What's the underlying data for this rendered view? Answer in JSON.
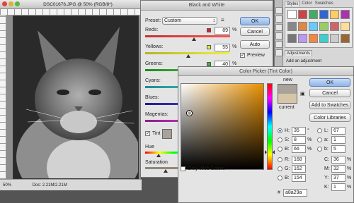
{
  "document": {
    "title": "DSC01676.JPG @ 50% (RGB/8*)",
    "zoom": "50%",
    "status": "Doc: 2.21M/2.21M"
  },
  "bw": {
    "title": "Black and White",
    "preset_label": "Preset:",
    "preset_value": "Custom",
    "ok": "OK",
    "cancel": "Cancel",
    "auto": "Auto",
    "preview": "Preview",
    "preview_checked": true,
    "sliders": [
      {
        "label": "Reds:",
        "value": "89",
        "unit": "%",
        "color": "#e02020",
        "g1": "#c23232",
        "g2": "#ff5050"
      },
      {
        "label": "Yellows:",
        "value": "55",
        "unit": "%",
        "color": "#e8e830",
        "g1": "#b4b41e",
        "g2": "#f0f040"
      },
      {
        "label": "Greens:",
        "value": "40",
        "unit": "%",
        "color": "#30c030",
        "g1": "#1e8c1e",
        "g2": "#50d050"
      },
      {
        "label": "Cyans:",
        "value": "",
        "unit": "",
        "color": "#30c0c0",
        "g1": "#1e8c8c",
        "g2": "#50d0d0"
      },
      {
        "label": "Blues:",
        "value": "",
        "unit": "",
        "color": "#2040e0",
        "g1": "#1e1e8c",
        "g2": "#5050f0"
      },
      {
        "label": "Magentas:",
        "value": "",
        "unit": "",
        "color": "#c030c0",
        "g1": "#8c1e8c",
        "g2": "#e050e0"
      }
    ],
    "tint_label": "Tint",
    "tint_checked": true,
    "tint_color": "#a8a29a",
    "hue_label": "Hue",
    "saturation_label": "Saturation"
  },
  "colorpicker": {
    "title": "Color Picker (Tint Color)",
    "ok": "OK",
    "cancel": "Cancel",
    "add_to_swatches": "Add to Swatches",
    "color_libraries": "Color Libraries",
    "new_label": "new",
    "current_label": "current",
    "new_color": "#a8a29a",
    "current_color": "#d7c5a8",
    "only_web_colors": "Only Web Colors",
    "hsb": [
      {
        "label": "H:",
        "value": "35",
        "unit": "°",
        "selected": true
      },
      {
        "label": "S:",
        "value": "8",
        "unit": "%",
        "selected": false
      },
      {
        "label": "B:",
        "value": "66",
        "unit": "%",
        "selected": false
      }
    ],
    "rgb": [
      {
        "label": "R:",
        "value": "168"
      },
      {
        "label": "G:",
        "value": "162"
      },
      {
        "label": "B:",
        "value": "154"
      }
    ],
    "lab": [
      {
        "label": "L:",
        "value": "67"
      },
      {
        "label": "a:",
        "value": "1"
      },
      {
        "label": "b:",
        "value": "5"
      }
    ],
    "cmyk": [
      {
        "label": "C:",
        "value": "36",
        "unit": "%"
      },
      {
        "label": "M:",
        "value": "32",
        "unit": "%"
      },
      {
        "label": "Y:",
        "value": "37",
        "unit": "%"
      },
      {
        "label": "K:",
        "value": "1",
        "unit": "%"
      }
    ],
    "hex_label": "#",
    "hex": "a8a29a"
  },
  "right_panel": {
    "tabs": [
      "Styles",
      "Color",
      "Swatches"
    ],
    "section2_tabs": [
      "Adjustments"
    ],
    "adjust_hint": "Add an adjustment"
  }
}
